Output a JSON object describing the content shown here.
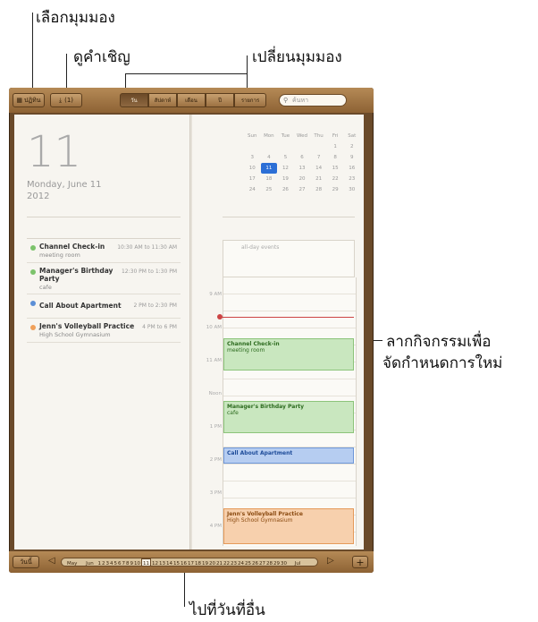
{
  "callouts": {
    "choose_view": "เลือกมุมมอง",
    "view_invitations": "ดูคำเชิญ",
    "change_view": "เปลี่ยนมุมมอง",
    "drag_reschedule_line1": "ลากกิจกรรมเพื่อ",
    "drag_reschedule_line2": "จัดกำหนดการใหม่",
    "go_to_other_date": "ไปที่วันที่อื่น"
  },
  "toolbar": {
    "calendars_label": "ปฏิทิน",
    "invites_label": "(1)",
    "tabs": [
      {
        "label": "วัน",
        "active": true
      },
      {
        "label": "สัปดาห์",
        "active": false
      },
      {
        "label": "เดือน",
        "active": false
      },
      {
        "label": "ปี",
        "active": false
      },
      {
        "label": "รายการ",
        "active": false
      }
    ],
    "search_placeholder": "ค้นหา"
  },
  "left_page": {
    "day_number": "11",
    "weekday_date": "Monday, June 11",
    "year": "2012",
    "events": [
      {
        "title": "Channel Check-in",
        "sub": "meeting room",
        "time": "10:30 AM to 11:30 AM",
        "color": "#7cc36b"
      },
      {
        "title": "Manager's Birthday Party",
        "sub": "cafe",
        "time": "12:30 PM to 1:30 PM",
        "color": "#7cc36b"
      },
      {
        "title": "Call About Apartment",
        "sub": "",
        "time": "2 PM to 2:30 PM",
        "color": "#5b8fd6"
      },
      {
        "title": "Jenn's Volleyball Practice",
        "sub": "High School Gymnasium",
        "time": "4 PM to 6 PM",
        "color": "#f0a05a"
      }
    ]
  },
  "right_page": {
    "weekdays": [
      "Sun",
      "Mon",
      "Tue",
      "Wed",
      "Thu",
      "Fri",
      "Sat"
    ],
    "weeks": [
      [
        "",
        "",
        "",
        "",
        "",
        "1",
        "2"
      ],
      [
        "3",
        "4",
        "5",
        "6",
        "7",
        "8",
        "9"
      ],
      [
        "10",
        "11",
        "12",
        "13",
        "14",
        "15",
        "16"
      ],
      [
        "17",
        "18",
        "19",
        "20",
        "21",
        "22",
        "23"
      ],
      [
        "24",
        "25",
        "26",
        "27",
        "28",
        "29",
        "30"
      ]
    ],
    "today": "11",
    "all_day_label": "all-day events",
    "hours": [
      "9 AM",
      "10 AM",
      "11 AM",
      "Noon",
      "1 PM",
      "2 PM",
      "3 PM",
      "4 PM"
    ],
    "blocks": [
      {
        "title": "Channel Check-in",
        "sub": "meeting room"
      },
      {
        "title": "Manager's Birthday Party",
        "sub": "cafe"
      },
      {
        "title": "Call About Apartment",
        "sub": ""
      },
      {
        "title": "Jenn's Volleyball Practice",
        "sub": "High School Gymnasium"
      }
    ]
  },
  "bottom_bar": {
    "today_label": "วันนี้",
    "month_start": "May",
    "month_mid": "Jun",
    "month_end": "Jul",
    "dates": [
      "1",
      "2",
      "3",
      "4",
      "5",
      "6",
      "7",
      "8",
      "9",
      "10",
      "11",
      "12",
      "13",
      "14",
      "15",
      "16",
      "17",
      "18",
      "19",
      "20",
      "21",
      "22",
      "23",
      "24",
      "25",
      "26",
      "27",
      "28",
      "29",
      "30"
    ],
    "current_date": "11",
    "colors": {
      "wood": "#8d6234",
      "page": "#f7f5f0",
      "accent": "#2c6fd6"
    }
  }
}
